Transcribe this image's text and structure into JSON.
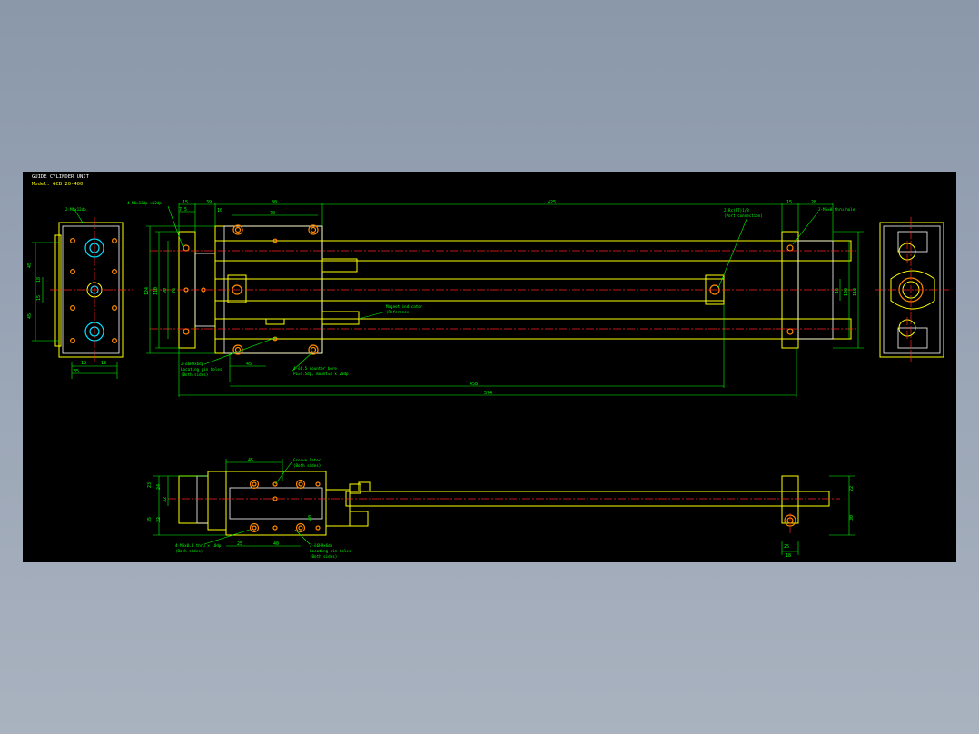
{
  "title": {
    "line1": "GUIDE CYLINDER UNIT",
    "line2": "Model: GCB 20-400"
  },
  "colors": {
    "background": "#000000",
    "outline": "#ffff00",
    "dimension": "#00ff00",
    "centerline": "#ff2020",
    "hole": "#ff8800",
    "bore": "#00e0ff",
    "edge": "#ffffff"
  },
  "callouts": {
    "left_top": "2-M6x12dp",
    "plate_holes": "4-M6x12dp x12dp",
    "port": "2-Rc(PT)1/8",
    "port_sub": "(Port connection)",
    "bolt": "2-M5x8 thru hole",
    "magnet": "Magnet indicator",
    "magnet_sub": "(Reference)",
    "pin_left": "2-ö6H9x6dp",
    "pin_left_sub1": "Locating pin holes",
    "pin_left_sub2": "(Both sides)",
    "counter": "4-ö6.5 counter bore",
    "counter_sub": "P1=4.5dp, mount=4 x 20dp",
    "groove": "Groove later",
    "groove_sub": "(Both sides)",
    "bottom_left": "4-M5x0.8 thru x 10dp",
    "bottom_left_sub": "(Both sides)",
    "bottom_right": "2-ö6H9x6dp",
    "bottom_right_sub1": "Locating pin holes",
    "bottom_right_sub2": "(Both sides)"
  },
  "dimensions": {
    "top_15": "15",
    "top_39": "39",
    "top_80": "80",
    "top_70": "70",
    "top_10": "10",
    "top_7_5": "7.5",
    "top_425": "425",
    "top_15r": "15",
    "top_28": "28",
    "left_45a": "45",
    "left_18": "18",
    "left_15": "15",
    "left_45b": "45",
    "left_w18": "18",
    "left_w19": "19",
    "left_w35": "35",
    "main_124": "124",
    "main_110": "110",
    "main_90": "90",
    "main_76": "76",
    "main_45": "45",
    "main_458": "458",
    "main_574": "574",
    "right_16": "16",
    "right_100": "100",
    "right_110": "110",
    "bot_45": "45",
    "bot_23": "23",
    "bot_24": "24",
    "bot_32": "32",
    "bot_35": "35",
    "bot_22a": "22",
    "bot_40": "40",
    "bot_25": "25",
    "bot_40b": "40",
    "bot_22": "22",
    "bot_30": "30",
    "bot_25b": "25",
    "bot_18": "18"
  }
}
